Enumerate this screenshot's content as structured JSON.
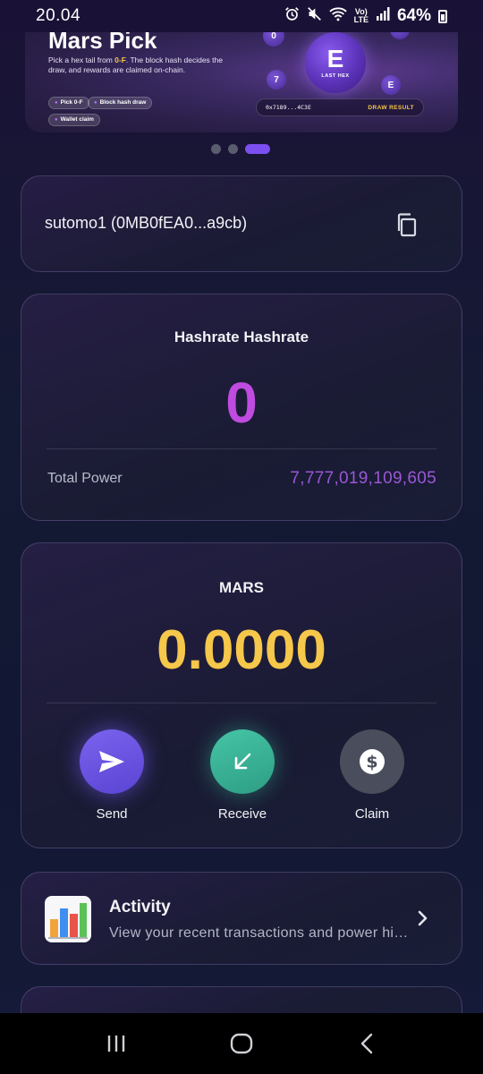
{
  "status_bar": {
    "time": "20.04",
    "lte_top": "Vo)",
    "lte_bottom": "LTE",
    "battery": "64%"
  },
  "banner": {
    "title": "Mars Pick",
    "desc_prefix": "Pick a hex tail from ",
    "desc_highlight": "0-F",
    "desc_suffix": ". The block hash decides the draw, and rewards are claimed on-chain.",
    "chips": [
      "Pick 0-F",
      "Block hash draw",
      "Wallet claim"
    ],
    "last_hex_letter": "E",
    "last_hex_label": "LAST HEX",
    "hex_balls": [
      "0",
      "7",
      "E"
    ],
    "hash_code": "0x7189...4C3E",
    "draw_result": "DRAW RESULT",
    "carousel_active_index": 2
  },
  "wallet": {
    "name": "sutomo1 (0MB0fEA0...a9cb)",
    "copy_icon": "copy-icon"
  },
  "hashrate": {
    "title": "Hashrate Hashrate",
    "value": "0",
    "total_power_label": "Total Power",
    "total_power_value": "7,777,019,109,605"
  },
  "mars": {
    "title": "MARS",
    "balance": "0.0000",
    "actions": [
      {
        "label": "Send",
        "icon": "send-icon"
      },
      {
        "label": "Receive",
        "icon": "receive-icon"
      },
      {
        "label": "Claim",
        "icon": "dollar-icon"
      }
    ]
  },
  "activity": {
    "title": "Activity",
    "subtitle": "View your recent transactions and power history",
    "icon": "bar-chart-icon"
  },
  "colors": {
    "hashrate_value": "#c04be0",
    "total_power": "#9a56d6",
    "mars_balance": "#f5c74a",
    "send": "#6a54e0",
    "receive": "#3bb598",
    "claim": "#4a4e5c"
  }
}
